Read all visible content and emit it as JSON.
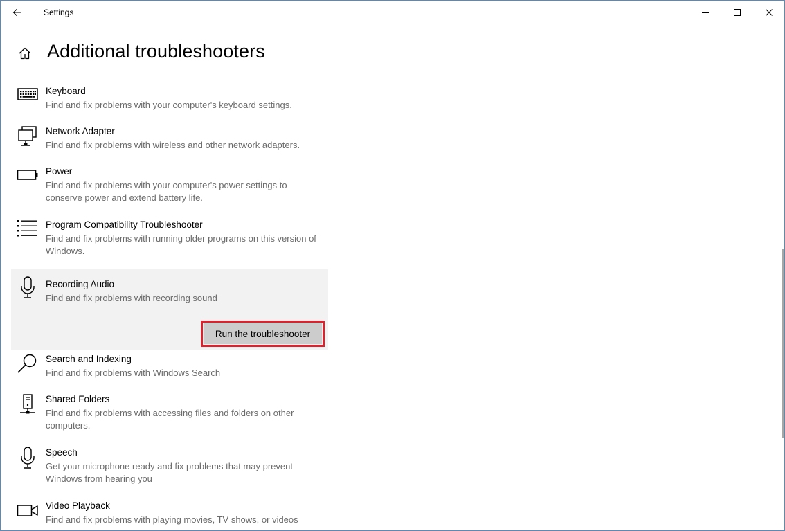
{
  "window": {
    "title": "Settings"
  },
  "header": {
    "title": "Additional troubleshooters"
  },
  "troubleshooters": [
    {
      "name": "Keyboard",
      "description": "Find and fix problems with your computer's keyboard settings.",
      "icon": "keyboard-icon"
    },
    {
      "name": "Network Adapter",
      "description": "Find and fix problems with wireless and other network adapters.",
      "icon": "network-adapter-icon"
    },
    {
      "name": "Power",
      "description": "Find and fix problems with your computer's power settings to conserve power and extend battery life.",
      "icon": "battery-icon"
    },
    {
      "name": "Program Compatibility Troubleshooter",
      "description": "Find and fix problems with running older programs on this version of Windows.",
      "icon": "list-icon"
    },
    {
      "name": "Recording Audio",
      "description": "Find and fix problems with recording sound",
      "icon": "microphone-icon",
      "selected": true,
      "button": "Run the troubleshooter"
    },
    {
      "name": "Search and Indexing",
      "description": "Find and fix problems with Windows Search",
      "icon": "search-icon"
    },
    {
      "name": "Shared Folders",
      "description": "Find and fix problems with accessing files and folders on other computers.",
      "icon": "shared-folders-icon"
    },
    {
      "name": "Speech",
      "description": "Get your microphone ready and fix problems that may prevent Windows from hearing you",
      "icon": "microphone-icon"
    },
    {
      "name": "Video Playback",
      "description": "Find and fix problems with playing movies, TV shows, or videos",
      "icon": "video-camera-icon"
    }
  ],
  "colors": {
    "highlight_border": "#d9232e",
    "selected_background": "#f2f2f2",
    "button_background": "#cccccc",
    "description_text": "#6b6b6b"
  }
}
